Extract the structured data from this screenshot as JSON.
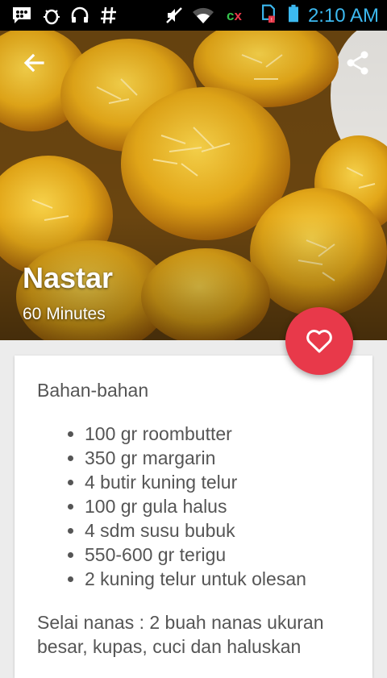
{
  "status_bar": {
    "time": "2:10 AM",
    "carrier_label": "cx",
    "icons": [
      "bbm-icon",
      "bug-icon",
      "headset-icon",
      "hash-icon",
      "mute-icon",
      "wifi-icon",
      "sim-icon",
      "battery-icon"
    ]
  },
  "hero": {
    "title": "Nastar",
    "subtitle": "60 Minutes"
  },
  "ingredients": {
    "heading": "Bahan-bahan",
    "items": [
      "100 gr roombutter",
      "350 gr margarin",
      "4 butir kuning telur",
      "100 gr gula halus",
      "4 sdm susu bubuk",
      "550-600 gr terigu",
      "2 kuning telur untuk olesan"
    ],
    "note": "Selai nanas : 2 buah nanas ukuran besar, kupas, cuci dan haluskan"
  },
  "colors": {
    "accent": "#e8394a",
    "clock": "#3cb9f0"
  }
}
